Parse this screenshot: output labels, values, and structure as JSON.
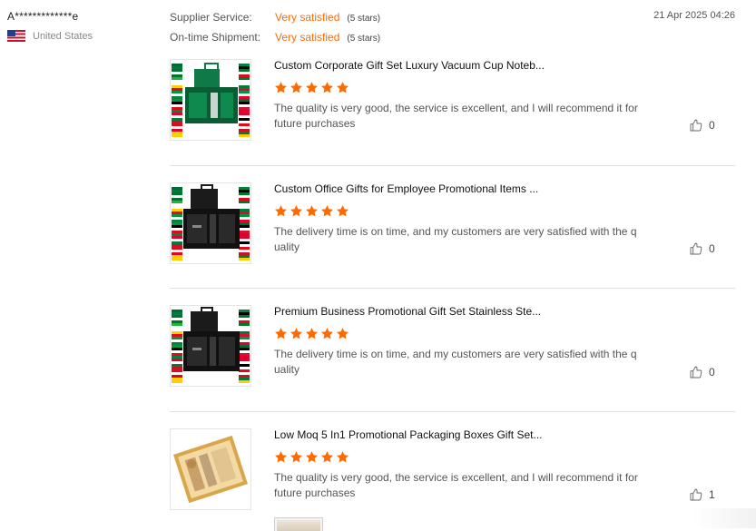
{
  "reviewer": {
    "name": "A*************e",
    "country": "United States",
    "flag_icon": "us-flag-icon"
  },
  "ratings": [
    {
      "label": "Supplier Service:",
      "value": "Very satisfied",
      "stars": "(5 stars)"
    },
    {
      "label": "On-time Shipment:",
      "value": "Very satisfied",
      "stars": "(5 stars)"
    }
  ],
  "date": "21 Apr 2025 04:26",
  "colors": {
    "accent": "#ff6a00",
    "star": "#ff6a00",
    "divider": "#e0e0e0"
  },
  "products": [
    {
      "title": "Custom Corporate Gift Set Luxury Vacuum Cup Noteb...",
      "rating": 5,
      "review": "The quality is very good, the service is excellent, and I will recommend it for future purchases",
      "likes": "0",
      "thumb_icon": "green-gift-set-image"
    },
    {
      "title": "Custom Office Gifts for Employee Promotional Items ...",
      "rating": 5,
      "review": "The delivery time is on time, and my customers are very satisfied with the quality",
      "likes": "0",
      "thumb_icon": "black-gift-set-image"
    },
    {
      "title": "Premium Business Promotional Gift Set Stainless Ste...",
      "rating": 5,
      "review": "The delivery time is on time, and my customers are very satisfied with the quality",
      "likes": "0",
      "thumb_icon": "black-gift-set-image"
    },
    {
      "title": "Low Moq 5 In1 Promotional Packaging Boxes Gift Set...",
      "rating": 5,
      "review": "The quality is very good, the service is excellent, and I will recommend it for future purchases",
      "likes": "1",
      "thumb_icon": "gold-gift-box-image"
    }
  ]
}
